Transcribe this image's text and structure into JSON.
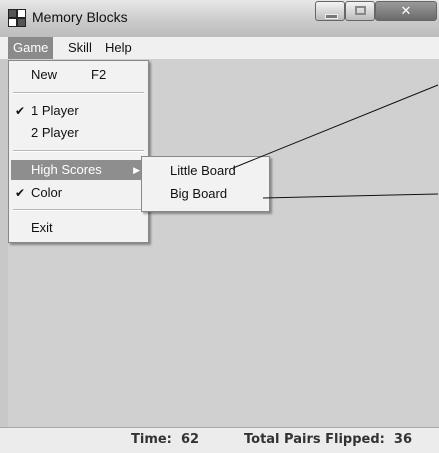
{
  "window": {
    "title": "Memory Blocks",
    "close_glyph": "✕"
  },
  "menubar": {
    "items": [
      {
        "label": "Game",
        "active": true
      },
      {
        "label": "Skill",
        "active": false
      },
      {
        "label": "Help",
        "active": false
      }
    ]
  },
  "game_menu": {
    "new_label": "New",
    "new_shortcut": "F2",
    "one_player_label": "1 Player",
    "one_player_checked": true,
    "two_player_label": "2 Player",
    "high_scores_label": "High Scores",
    "color_label": "Color",
    "color_checked": true,
    "exit_label": "Exit",
    "check_glyph": "✔",
    "submenu_arrow": "▶"
  },
  "high_scores_submenu": {
    "items": [
      "Little Board",
      "Big Board"
    ]
  },
  "statusbar": {
    "time_label": "Time:",
    "time_value": "62",
    "pairs_label": "Total Pairs Flipped:",
    "pairs_value": "36"
  },
  "icons": {
    "app": "grid-icon",
    "minimize": "minimize-icon",
    "maximize": "maximize-icon",
    "close": "close-icon"
  }
}
